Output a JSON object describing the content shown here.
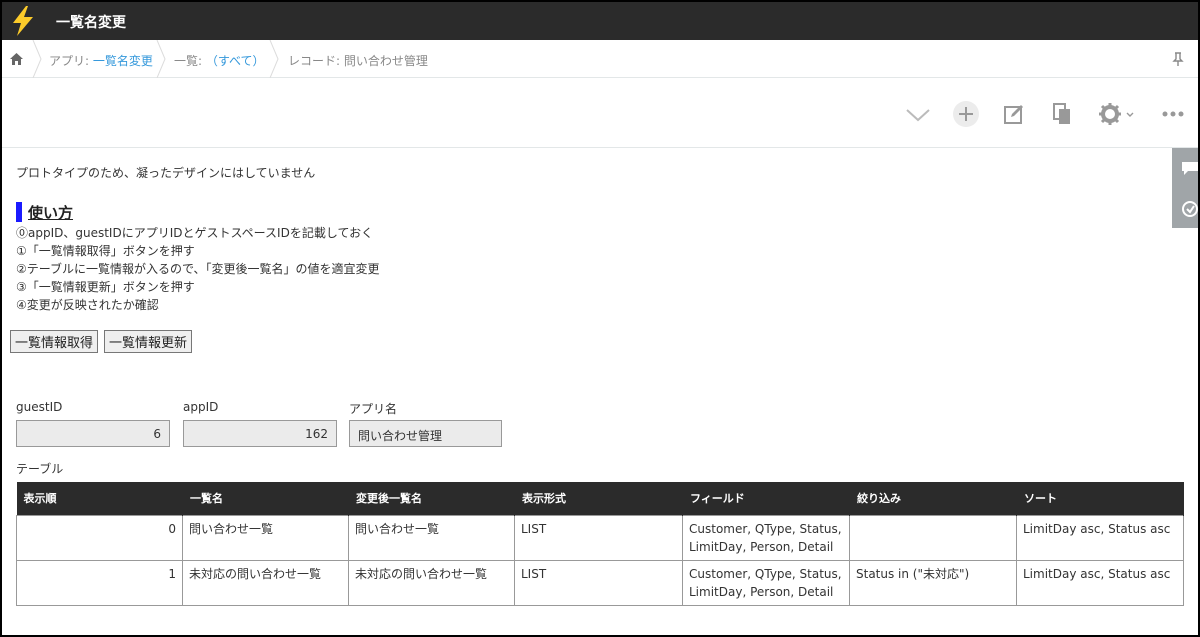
{
  "header": {
    "app_name": "一覧名変更"
  },
  "breadcrumb": {
    "app_prefix": "アプリ: ",
    "app_link": "一覧名変更",
    "list_prefix": "一覧: ",
    "list_link": "（すべて）",
    "record_label": "レコード: 問い合わせ管理"
  },
  "toolbar": {
    "icons": [
      "chevron-down-icon",
      "add-icon",
      "edit-icon",
      "copy-icon",
      "gear-icon",
      "more-icon"
    ]
  },
  "content": {
    "note": "プロトタイプのため、凝ったデザインにはしていません",
    "usage_title": "使い方",
    "steps": [
      "⓪appID、guestIDにアプリIDとゲストスペースIDを記載しておく",
      "①「一覧情報取得」ボタンを押す",
      "②テーブルに一覧情報が入るので、「変更後一覧名」の値を適宜変更",
      "③「一覧情報更新」ボタンを押す",
      "④変更が反映されたか確認"
    ],
    "buttons": {
      "fetch": "一覧情報取得",
      "update": "一覧情報更新"
    }
  },
  "fields": {
    "guest_label": "guestID",
    "guest_value": "6",
    "app_label": "appID",
    "app_value": "162",
    "appname_label": "アプリ名",
    "appname_value": "問い合わせ管理"
  },
  "table": {
    "label": "テーブル",
    "headers": [
      "表示順",
      "一覧名",
      "変更後一覧名",
      "表示形式",
      "フィールド",
      "絞り込み",
      "ソート"
    ],
    "rows": [
      [
        "0",
        "問い合わせ一覧",
        "問い合わせ一覧",
        "LIST",
        "Customer, QType, Status, LimitDay, Person, Detail",
        "",
        "LimitDay asc, Status asc"
      ],
      [
        "1",
        "未対応の問い合わせ一覧",
        "未対応の問い合わせ一覧",
        "LIST",
        "Customer, QType, Status, LimitDay, Person, Detail",
        "Status in (\"未対応\")",
        "LimitDay asc, Status asc"
      ]
    ]
  },
  "colors": {
    "header_bg": "#2b2b2b",
    "link": "#3498db",
    "heading_bar": "#1a1aff",
    "logo_bg": "#fccb2a"
  }
}
